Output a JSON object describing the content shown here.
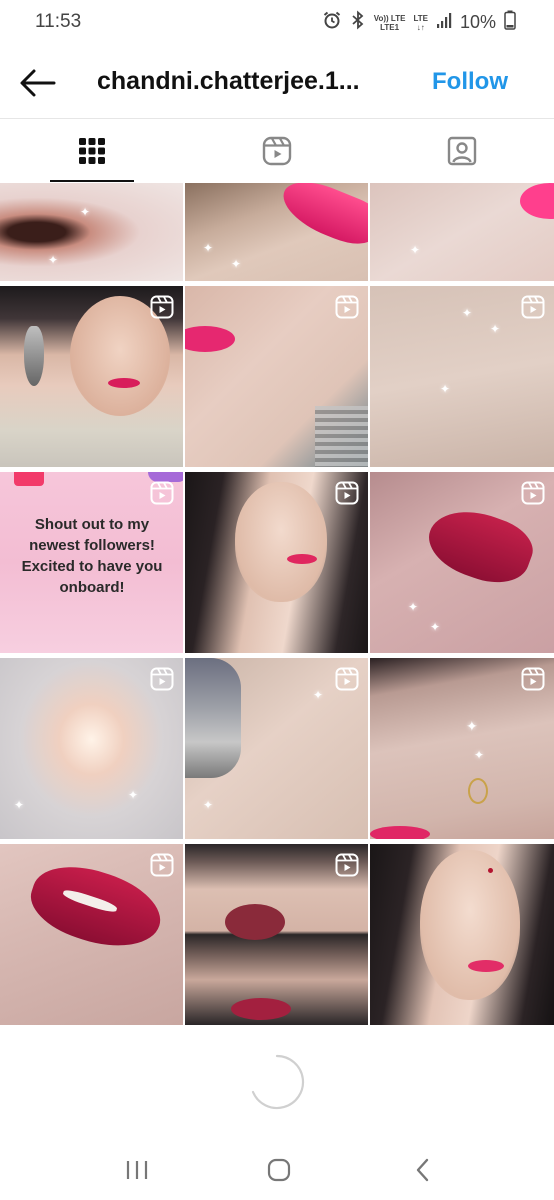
{
  "status_bar": {
    "time": "11:53",
    "network_label_top": "Vo)) LTE",
    "network_label_bottom": "LTE1",
    "lte_label": "LTE",
    "battery": "10%"
  },
  "header": {
    "username": "chandni.chatterjee.1...",
    "follow_label": "Follow",
    "follow_color": "#2196e8"
  },
  "tabs": [
    {
      "icon": "grid-icon",
      "active": true
    },
    {
      "icon": "reels-icon",
      "active": false
    },
    {
      "icon": "tagged-icon",
      "active": false
    }
  ],
  "posts": {
    "shout_out_text": "Shout out to my newest followers! Excited to have you onboard!",
    "items": [
      {
        "type": "photo",
        "subject": "nose close-up",
        "reel": false
      },
      {
        "type": "photo",
        "subject": "pink lips close-up",
        "reel": false
      },
      {
        "type": "photo",
        "subject": "lips corner close-up",
        "reel": false
      },
      {
        "type": "reel",
        "subject": "woman with jhumka earring",
        "reel": true
      },
      {
        "type": "reel",
        "subject": "lips and cheek",
        "reel": true
      },
      {
        "type": "reel",
        "subject": "skin close-up",
        "reel": true
      },
      {
        "type": "reel",
        "subject": "shout out card",
        "reel": true
      },
      {
        "type": "reel",
        "subject": "woman smiling",
        "reel": true
      },
      {
        "type": "reel",
        "subject": "red lips",
        "reel": true
      },
      {
        "type": "reel",
        "subject": "blurred light",
        "reel": true
      },
      {
        "type": "reel",
        "subject": "earring and neck",
        "reel": true
      },
      {
        "type": "reel",
        "subject": "nose ring",
        "reel": true
      },
      {
        "type": "reel",
        "subject": "red lips smile",
        "reel": true
      },
      {
        "type": "reel",
        "subject": "lips collage",
        "reel": true
      },
      {
        "type": "photo",
        "subject": "woman portrait",
        "reel": false
      }
    ]
  },
  "colors": {
    "accent": "#2196e8",
    "text_primary": "#111111",
    "divider": "#e6e6e6"
  }
}
